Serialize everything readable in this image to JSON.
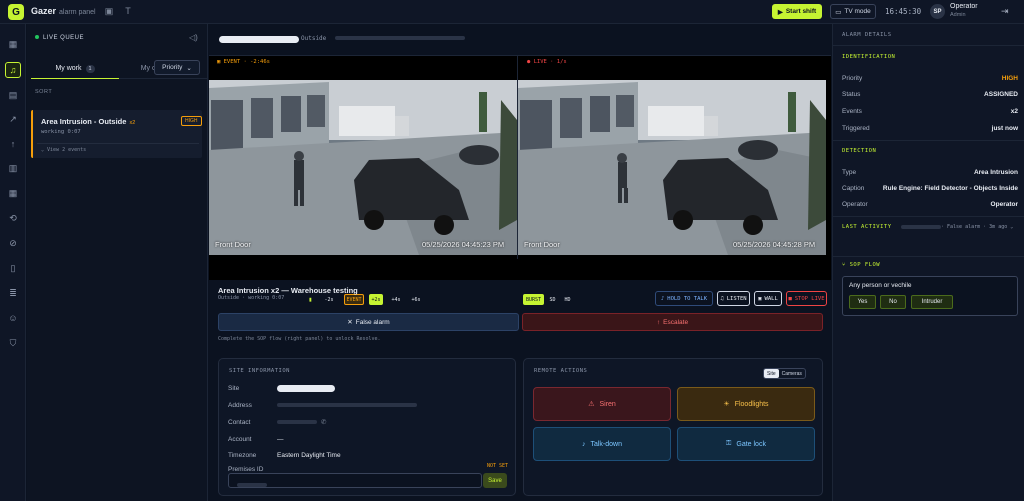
{
  "app": {
    "logo": "G",
    "name": "Gazer",
    "subtitle": "alarm panel"
  },
  "topbar": {
    "start_shift": "Start shift",
    "tv_mode": "TV mode",
    "clock": "16:45:30",
    "avatar": "SP",
    "user_name": "Operator",
    "user_role": "Admin"
  },
  "queue": {
    "title": "LIVE QUEUE",
    "tabs": [
      {
        "label": "My work",
        "count": "1"
      },
      {
        "label": "My closed",
        "count": "5"
      }
    ],
    "sort_label": "SORT",
    "sort_value": "Priority",
    "alarm": {
      "title": "Area Intrusion - Outside",
      "count": "x2",
      "priority": "HIGH",
      "status": "working 0:07",
      "view": "View 2 events"
    }
  },
  "camera": {
    "location": "Outside",
    "event_label": "EVENT · -2:46s",
    "live_label": "LIVE · 1/s",
    "left_name": "Front Door",
    "left_time": "05/25/2026 04:45:23 PM",
    "right_name": "Front Door",
    "right_time": "05/25/2026 04:45:28 PM",
    "scrub": [
      "-2s",
      "EVENT",
      "+2s",
      "+4s",
      "+6s"
    ],
    "quality": [
      "BURST",
      "SD",
      "HD"
    ],
    "hold_to_talk": "HOLD TO TALK",
    "listen": "LISTEN",
    "wall": "WALL",
    "stop_live": "STOP LIVE"
  },
  "incident": {
    "title": "Area Intrusion x2 — Warehouse testing",
    "subtitle": "Outside · working 0:07",
    "false_alarm": "False alarm",
    "escalate": "Escalate",
    "hint": "Complete the SOP flow (right panel) to unlock Resolve."
  },
  "site": {
    "header": "SITE INFORMATION",
    "rows": [
      {
        "label": "Site",
        "value": ""
      },
      {
        "label": "Address",
        "value": ""
      },
      {
        "label": "Contact",
        "value": ""
      },
      {
        "label": "Account",
        "value": "—"
      },
      {
        "label": "Timezone",
        "value": "Eastern Daylight Time"
      }
    ],
    "premises_label": "Premises ID",
    "premises_status": "NOT SET",
    "save": "Save"
  },
  "remote": {
    "header": "REMOTE ACTIONS",
    "toggle": [
      "Site",
      "Cameras"
    ],
    "actions": [
      {
        "label": "Siren",
        "icon": "siren-icon",
        "color": "#ef4444"
      },
      {
        "label": "Floodlights",
        "icon": "bulb-icon",
        "color": "#f59e0b"
      },
      {
        "label": "Talk-down",
        "icon": "mic-icon",
        "color": "#38bdf8"
      },
      {
        "label": "Gate lock",
        "icon": "lock-icon",
        "color": "#38bdf8"
      }
    ]
  },
  "details": {
    "header": "ALARM DETAILS",
    "identification": "IDENTIFICATION",
    "id_rows": [
      {
        "label": "Priority",
        "value": "HIGH"
      },
      {
        "label": "Status",
        "value": "ASSIGNED"
      },
      {
        "label": "Events",
        "value": "x2"
      },
      {
        "label": "Triggered",
        "value": "just now"
      }
    ],
    "detection": "DETECTION",
    "det_rows": [
      {
        "label": "Type",
        "value": "Area Intrusion"
      },
      {
        "label": "Caption",
        "value": "Rule Engine: Field Detector - Objects Inside"
      },
      {
        "label": "Operator",
        "value": "Operator"
      }
    ],
    "last_activity": "LAST ACTIVITY",
    "last_activity_text": "· False alarm · 3m ago",
    "sop_flow": "SOP FLOW",
    "sop_question": "Any person or vechile",
    "sop_options": [
      "Yes",
      "No",
      "Intruder"
    ]
  },
  "colors": {
    "accent": "#c6f432",
    "high": "#f59e0b",
    "danger": "#ef4444",
    "info": "#38bdf8"
  }
}
